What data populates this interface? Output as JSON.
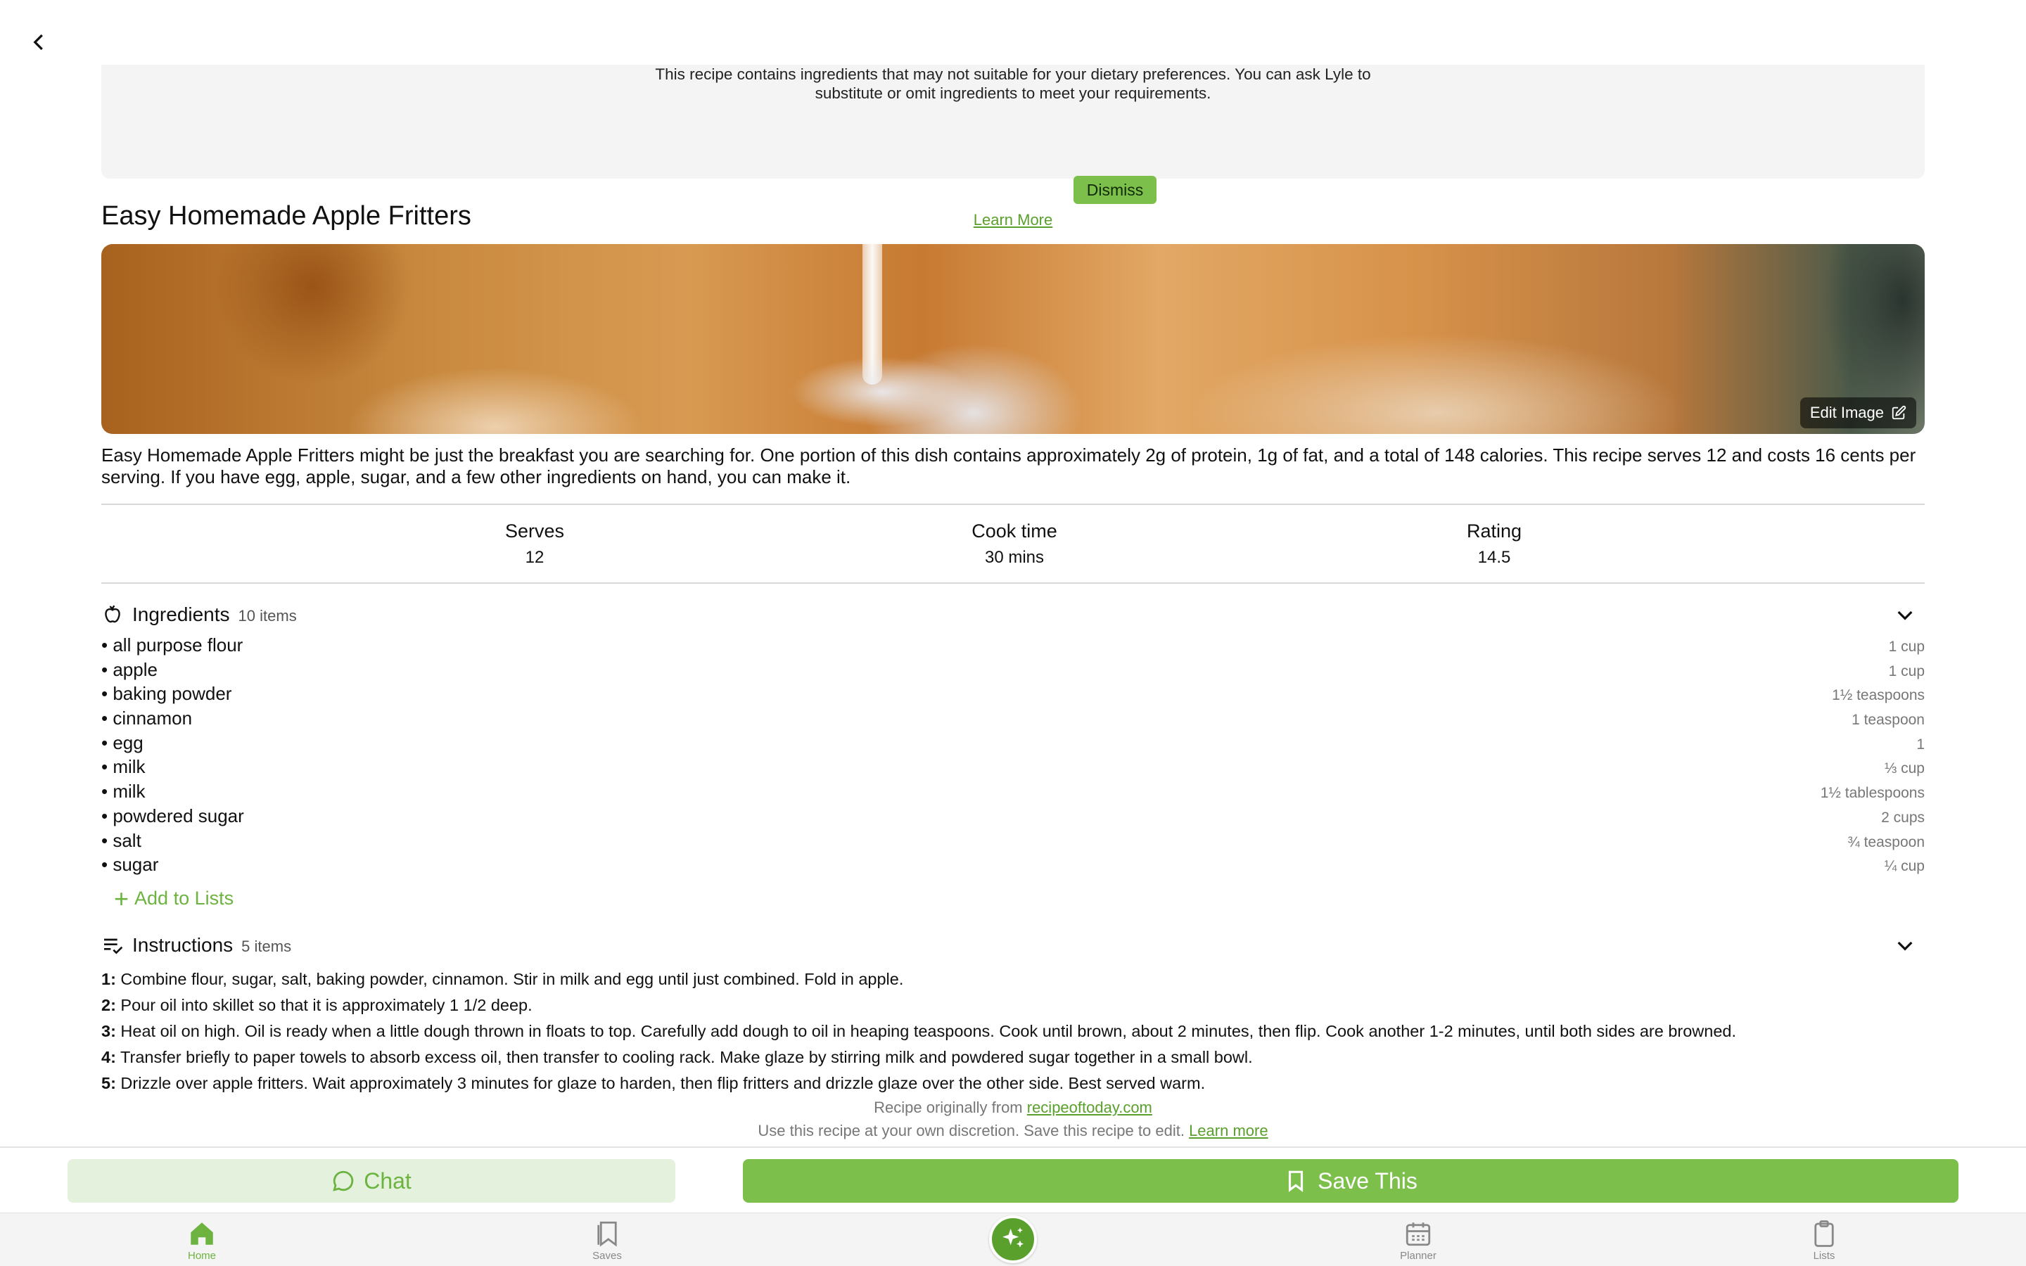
{
  "colors": {
    "accent": "#7cc04b",
    "accent_dark": "#5aa02c",
    "accent_light_bg": "#e4f1dc",
    "banner_bg": "#f4f4f4"
  },
  "banner": {
    "line1": "This recipe contains ingredients that may not suitable for your dietary preferences. You can ask Lyle to",
    "line2": "substitute or omit ingredients to meet your requirements.",
    "dismiss_label": "Dismiss",
    "learn_more_label": "Learn More"
  },
  "recipe": {
    "title": "Easy Homemade Apple Fritters",
    "edit_image_label": "Edit Image",
    "description": "Easy Homemade Apple Fritters might be just the breakfast you are searching for. One portion of this dish contains approximately 2g of protein, 1g of fat, and a total of 148 calories. This recipe serves 12 and costs 16 cents per serving. If you have egg, apple, sugar, and a few other ingredients on hand, you can make it."
  },
  "stats": {
    "serves_label": "Serves",
    "serves_value": "12",
    "cook_label": "Cook time",
    "cook_value": "30 mins",
    "rating_label": "Rating",
    "rating_value": "14.5"
  },
  "ingredients": {
    "title": "Ingredients",
    "count": "10 items",
    "items": [
      {
        "name": "all purpose flour",
        "qty": "1 cup"
      },
      {
        "name": "apple",
        "qty": "1 cup"
      },
      {
        "name": "baking powder",
        "qty": "1½ teaspoons"
      },
      {
        "name": "cinnamon",
        "qty": "1 teaspoon"
      },
      {
        "name": "egg",
        "qty": "1"
      },
      {
        "name": "milk",
        "qty": "⅓ cup"
      },
      {
        "name": "milk",
        "qty": "1½ tablespoons"
      },
      {
        "name": "powdered sugar",
        "qty": "2 cups"
      },
      {
        "name": "salt",
        "qty": "¾ teaspoon"
      },
      {
        "name": "sugar",
        "qty": "¼ cup"
      }
    ],
    "add_to_lists_label": "Add to Lists"
  },
  "instructions": {
    "title": "Instructions",
    "count": "5 items",
    "steps": [
      {
        "num": "1:",
        "text": " Combine flour, sugar, salt, baking powder, cinnamon. Stir in milk and egg until just combined. Fold in apple."
      },
      {
        "num": "2:",
        "text": " Pour oil into skillet so that it is approximately 1 1/2 deep."
      },
      {
        "num": "3:",
        "text": " Heat oil on high. Oil is ready when a little dough thrown in floats to top. Carefully add dough to oil in heaping teaspoons. Cook until brown, about 2 minutes, then flip. Cook another 1-2 minutes, until both sides are browned."
      },
      {
        "num": "4:",
        "text": " Transfer briefly to paper towels to absorb excess oil, then transfer to cooling rack. Make glaze by stirring milk and powdered sugar together in a small bowl."
      },
      {
        "num": "5:",
        "text": " Drizzle over apple fritters. Wait approximately 3 minutes for glaze to harden, then flip fritters and drizzle glaze over the other side. Best served warm."
      }
    ]
  },
  "origin": {
    "prefix": "Recipe originally from ",
    "source_link": "recipeoftoday.com",
    "disclaimer": "Use this recipe at your own discretion. Save this recipe to edit. ",
    "learn_more_label": "Learn more"
  },
  "actions": {
    "chat_label": "Chat",
    "save_label": "Save This"
  },
  "tabs": {
    "home": "Home",
    "saves": "Saves",
    "planner": "Planner",
    "lists": "Lists"
  }
}
